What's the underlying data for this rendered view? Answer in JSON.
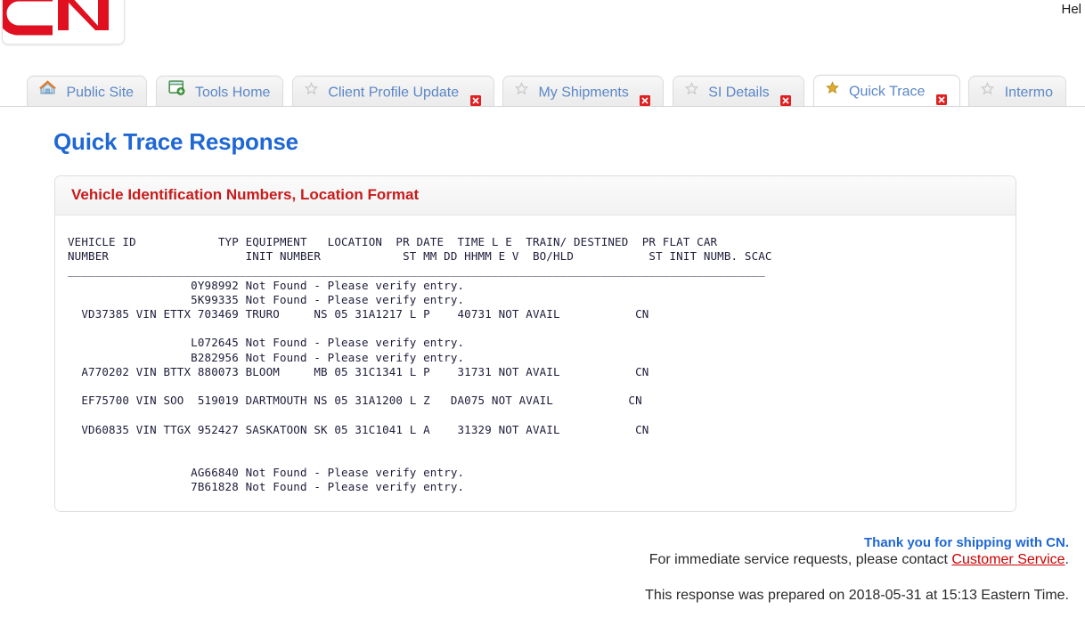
{
  "browser": {
    "help_label": "Hel",
    "tabs": [
      {
        "label": "Public Site",
        "icon": "house-icon",
        "active": false,
        "starred": false,
        "closable": false
      },
      {
        "label": "Tools Home",
        "icon": "window-add-icon",
        "active": false,
        "starred": false,
        "closable": false
      },
      {
        "label": "Client Profile Update",
        "icon": "star-outline-icon",
        "active": false,
        "starred": false,
        "closable": true
      },
      {
        "label": "My Shipments",
        "icon": "star-outline-icon",
        "active": false,
        "starred": false,
        "closable": true
      },
      {
        "label": "SI Details",
        "icon": "star-outline-icon",
        "active": false,
        "starred": false,
        "closable": true
      },
      {
        "label": "Quick Trace",
        "icon": "star-filled-icon",
        "active": true,
        "starred": true,
        "closable": true
      },
      {
        "label": "Intermo",
        "icon": "star-outline-icon",
        "active": false,
        "starred": false,
        "closable": false
      }
    ],
    "close_icon_name": "tab-close-icon"
  },
  "logo": {
    "alt": "CN",
    "color": "#e01020"
  },
  "page": {
    "title": "Quick Trace Response"
  },
  "panel": {
    "title": "Vehicle Identification Numbers, Location Format"
  },
  "report": {
    "header_line_1": "VEHICLE ID            TYP EQUIPMENT   LOCATION  PR DATE  TIME L E  TRAIN/ DESTINED  PR FLAT CAR",
    "header_line_2": "NUMBER                    INIT NUMBER            ST MM DD HHMM E V  BO/HLD           ST INIT NUMB. SCAC",
    "rule_line": "______________________________________________________________________________________________________",
    "columns": [
      "VEHICLE ID NUMBER",
      "TYP",
      "EQUIPMENT INIT",
      "EQUIPMENT NUMBER",
      "LOCATION",
      "PR ST",
      "DATE MM DD",
      "TIME HHMM",
      "L E",
      "E V",
      "TRAIN/ BO/HLD",
      "DESTINED",
      "PR ST",
      "FLAT INIT",
      "CAR NUMB.",
      "SCAC"
    ],
    "body_lines": [
      "                  0Y98992 Not Found - Please verify entry.",
      "                  5K99335 Not Found - Please verify entry.",
      "  VD37385 VIN ETTX 703469 TRURO     NS 05 31A1217 L P    40731 NOT AVAIL           CN",
      "",
      "                  L072645 Not Found - Please verify entry.",
      "                  B282956 Not Found - Please verify entry.",
      "  A770202 VIN BTTX 880073 BLOOM     MB 05 31C1341 L P    31731 NOT AVAIL           CN",
      "",
      "  EF75700 VIN SOO  519019 DARTMOUTH NS 05 31A1200 L Z   DA075 NOT AVAIL           CN",
      "",
      "  VD60835 VIN TTGX 952427 SASKATOON SK 05 31C1041 L A    31329 NOT AVAIL           CN",
      "",
      "",
      "                  AG66840 Not Found - Please verify entry.",
      "                  7B61828 Not Found - Please verify entry."
    ],
    "rows": [
      {
        "vehicle_id": "0Y98992",
        "status": "Not Found - Please verify entry."
      },
      {
        "vehicle_id": "5K99335",
        "status": "Not Found - Please verify entry."
      },
      {
        "vehicle_id": "VD37385",
        "typ": "VIN",
        "equip_init": "ETTX",
        "equip_number": "703469",
        "location": "TRURO",
        "pr_st": "NS",
        "date_mm": "05",
        "date_dd": "31",
        "time": "A1217",
        "le": "L",
        "ev": "P",
        "train": "40731",
        "destined": "NOT AVAIL",
        "scac": "CN"
      },
      {
        "vehicle_id": "L072645",
        "status": "Not Found - Please verify entry."
      },
      {
        "vehicle_id": "B282956",
        "status": "Not Found - Please verify entry."
      },
      {
        "vehicle_id": "A770202",
        "typ": "VIN",
        "equip_init": "BTTX",
        "equip_number": "880073",
        "location": "BLOOM",
        "pr_st": "MB",
        "date_mm": "05",
        "date_dd": "31",
        "time": "C1341",
        "le": "L",
        "ev": "P",
        "train": "31731",
        "destined": "NOT AVAIL",
        "scac": "CN"
      },
      {
        "vehicle_id": "EF75700",
        "typ": "VIN",
        "equip_init": "SOO",
        "equip_number": "519019",
        "location": "DARTMOUTH",
        "pr_st": "NS",
        "date_mm": "05",
        "date_dd": "31",
        "time": "A1200",
        "le": "L",
        "ev": "Z",
        "train": "DA075",
        "destined": "NOT AVAIL",
        "scac": "CN"
      },
      {
        "vehicle_id": "VD60835",
        "typ": "VIN",
        "equip_init": "TTGX",
        "equip_number": "952427",
        "location": "SASKATOON",
        "pr_st": "SK",
        "date_mm": "05",
        "date_dd": "31",
        "time": "C1041",
        "le": "L",
        "ev": "A",
        "train": "31329",
        "destined": "NOT AVAIL",
        "scac": "CN"
      },
      {
        "vehicle_id": "AG66840",
        "status": "Not Found - Please verify entry."
      },
      {
        "vehicle_id": "7B61828",
        "status": "Not Found - Please verify entry."
      }
    ]
  },
  "footer": {
    "thanks": "Thank you for shipping with CN.",
    "contact_prefix": "For immediate service requests, please contact ",
    "contact_link": "Customer Service",
    "contact_suffix": ".",
    "prepared": "This response was prepared on 2018-05-31 at 15:13 Eastern Time."
  }
}
